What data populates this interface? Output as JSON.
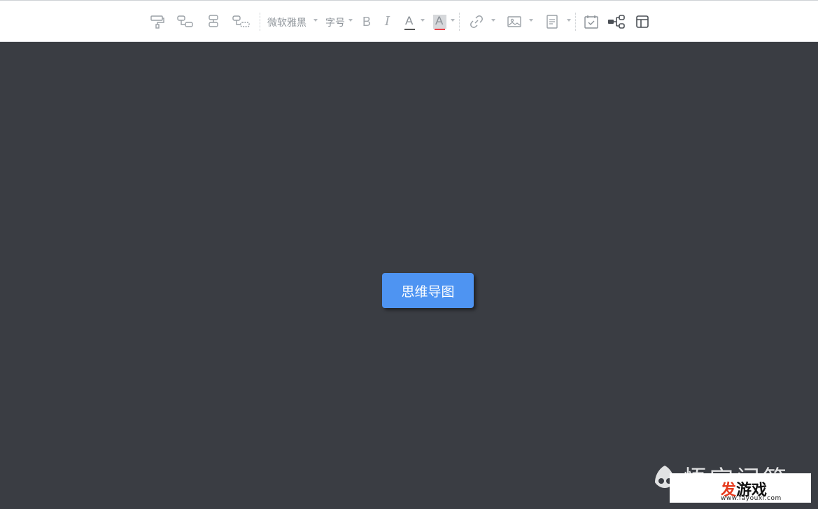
{
  "toolbar": {
    "font_family": "微软雅黑",
    "font_size": "字号",
    "bold": "B",
    "italic": "I",
    "font_color": "A",
    "highlight": "A",
    "colors": {
      "underline_font": "#555555",
      "underline_highlight": "#e8434a",
      "icon": "#9aa0a6"
    }
  },
  "canvas": {
    "root_node": "思维导图",
    "background": "#3a3d43",
    "node_color": "#4e94f2"
  },
  "watermark": {
    "left_text": "悟空问答",
    "main_red": "发",
    "main_black": "游戏",
    "url": "www.fayouxi.com"
  }
}
